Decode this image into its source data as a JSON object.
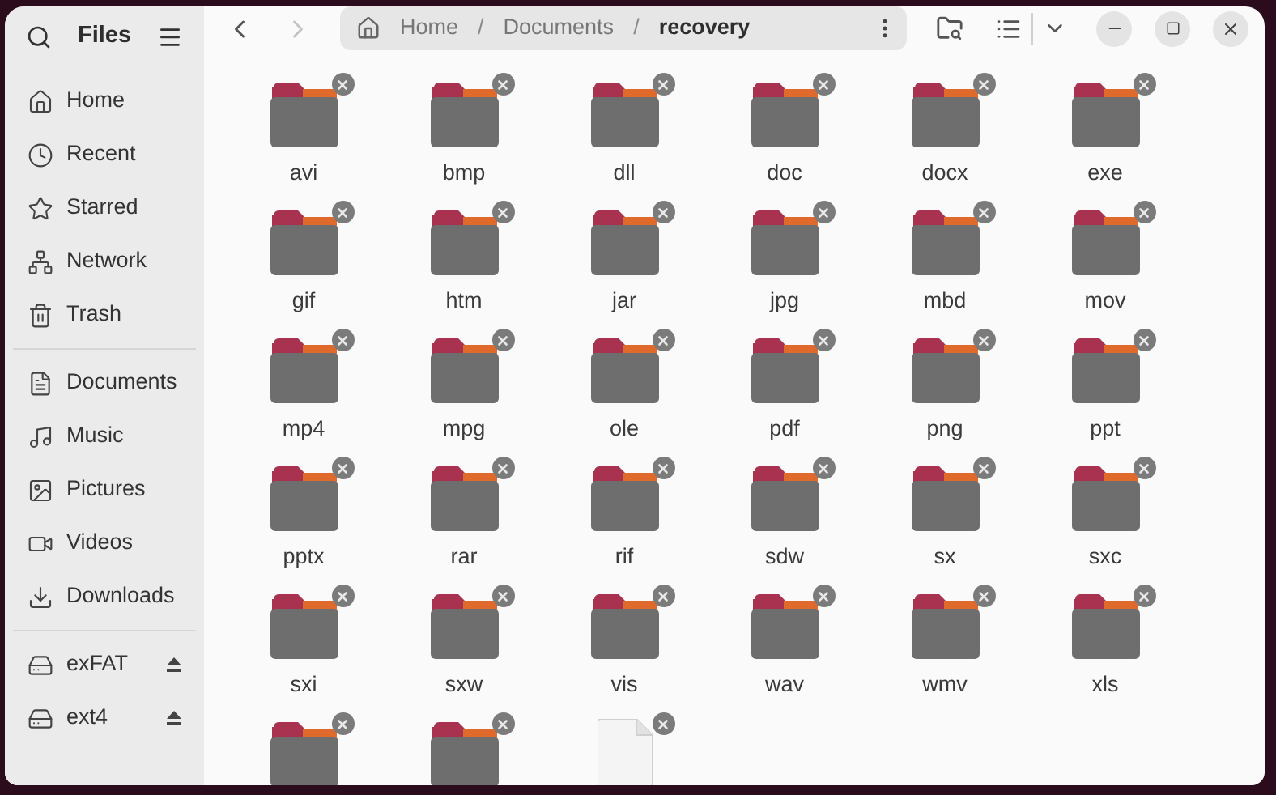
{
  "sidebar": {
    "title": "Files",
    "sections": [
      [
        {
          "label": "Home"
        },
        {
          "label": "Recent"
        },
        {
          "label": "Starred"
        },
        {
          "label": "Network"
        },
        {
          "label": "Trash"
        }
      ],
      [
        {
          "label": "Documents"
        },
        {
          "label": "Music"
        },
        {
          "label": "Pictures"
        },
        {
          "label": "Videos"
        },
        {
          "label": "Downloads"
        }
      ],
      [
        {
          "label": "exFAT",
          "ejectable": true
        },
        {
          "label": "ext4",
          "ejectable": true
        }
      ]
    ]
  },
  "toolbar": {
    "back_disabled": false,
    "forward_disabled": true,
    "path": [
      {
        "label": "Home",
        "current": false
      },
      {
        "separator": "/"
      },
      {
        "label": "Documents",
        "current": false
      },
      {
        "separator": "/"
      },
      {
        "label": "recovery",
        "current": true
      }
    ]
  },
  "items": [
    {
      "kind": "folder",
      "name": "avi"
    },
    {
      "kind": "folder",
      "name": "bmp"
    },
    {
      "kind": "folder",
      "name": "dll"
    },
    {
      "kind": "folder",
      "name": "doc"
    },
    {
      "kind": "folder",
      "name": "docx"
    },
    {
      "kind": "folder",
      "name": "exe"
    },
    {
      "kind": "folder",
      "name": "gif"
    },
    {
      "kind": "folder",
      "name": "htm"
    },
    {
      "kind": "folder",
      "name": "jar"
    },
    {
      "kind": "folder",
      "name": "jpg"
    },
    {
      "kind": "folder",
      "name": "mbd"
    },
    {
      "kind": "folder",
      "name": "mov"
    },
    {
      "kind": "folder",
      "name": "mp4"
    },
    {
      "kind": "folder",
      "name": "mpg"
    },
    {
      "kind": "folder",
      "name": "ole"
    },
    {
      "kind": "folder",
      "name": "pdf"
    },
    {
      "kind": "folder",
      "name": "png"
    },
    {
      "kind": "folder",
      "name": "ppt"
    },
    {
      "kind": "folder",
      "name": "pptx"
    },
    {
      "kind": "folder",
      "name": "rar"
    },
    {
      "kind": "folder",
      "name": "rif"
    },
    {
      "kind": "folder",
      "name": "sdw"
    },
    {
      "kind": "folder",
      "name": "sx"
    },
    {
      "kind": "folder",
      "name": "sxc"
    },
    {
      "kind": "folder",
      "name": "sxi"
    },
    {
      "kind": "folder",
      "name": "sxw"
    },
    {
      "kind": "folder",
      "name": "vis"
    },
    {
      "kind": "folder",
      "name": "wav"
    },
    {
      "kind": "folder",
      "name": "wmv"
    },
    {
      "kind": "folder",
      "name": "xls"
    },
    {
      "kind": "folder"
    },
    {
      "kind": "folder"
    },
    {
      "kind": "file"
    }
  ]
}
